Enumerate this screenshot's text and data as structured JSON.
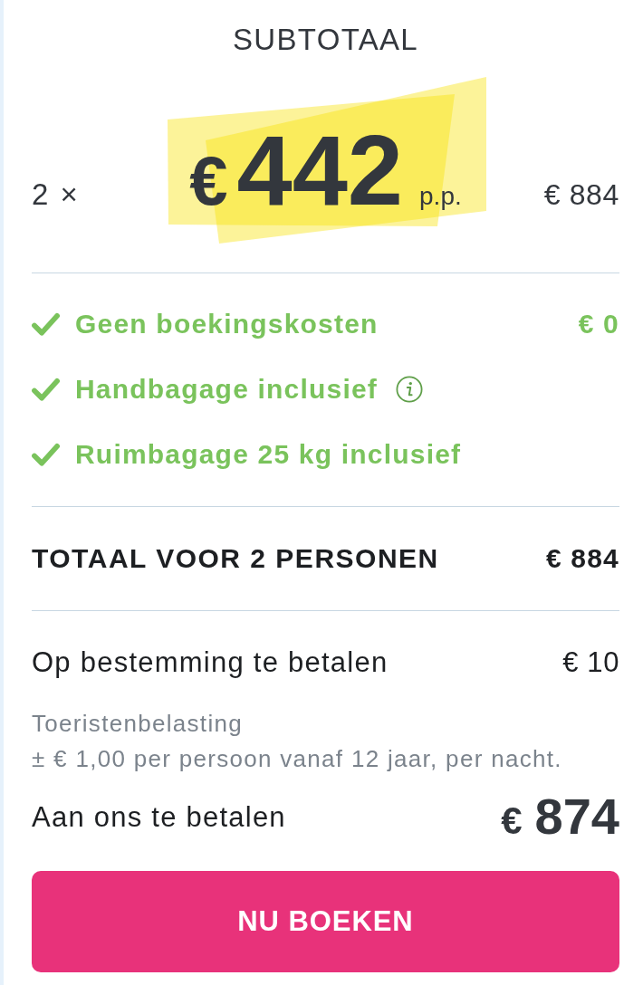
{
  "heading": "SUBTOTAAL",
  "price": {
    "quantity": "2 ×",
    "currency": "€",
    "amount": "442",
    "unit": "p.p.",
    "line_total": "€ 884"
  },
  "features": [
    {
      "label": "Geen boekingskosten",
      "value": "€ 0",
      "info": false
    },
    {
      "label": "Handbagage inclusief",
      "info": true
    },
    {
      "label": "Ruimbagage 25 kg inclusief",
      "info": false
    }
  ],
  "total": {
    "label": "TOTAAL VOOR 2 PERSONEN",
    "value": "€ 884"
  },
  "on_site": {
    "label": "Op bestemming te betalen",
    "value": "€ 10",
    "note_title": "Toeristenbelasting",
    "note": "± € 1,00 per persoon vanaf 12 jaar, per nacht."
  },
  "to_pay": {
    "label": "Aan ons te betalen",
    "currency": "€",
    "amount": "874"
  },
  "button": "NU BOEKEN"
}
